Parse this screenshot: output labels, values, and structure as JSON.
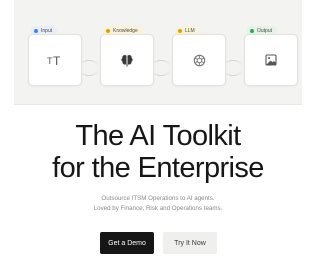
{
  "pipeline": {
    "steps": [
      {
        "label": "Input",
        "dot_color": "#3b82f6",
        "pill_bg": "#e8eef9",
        "icon": "text-icon"
      },
      {
        "label": "Knowledge",
        "dot_color": "#e0a100",
        "pill_bg": "#fbf3d9",
        "icon": "brain-icon"
      },
      {
        "label": "LLM",
        "dot_color": "#e0a100",
        "pill_bg": "#fbf3d9",
        "icon": "openai-icon"
      },
      {
        "label": "Output",
        "dot_color": "#2fa84f",
        "pill_bg": "#e3f4e6",
        "icon": "image-icon"
      }
    ]
  },
  "hero": {
    "title_line1": "The AI Toolkit",
    "title_line2": "for the Enterprise",
    "subtitle_line1": "Outsource ITSM Operations to AI agents.",
    "subtitle_line2": "Loved by Finance, Risk and Operations teams."
  },
  "actions": {
    "primary_label": "Get a Demo",
    "secondary_label": "Try It Now"
  }
}
